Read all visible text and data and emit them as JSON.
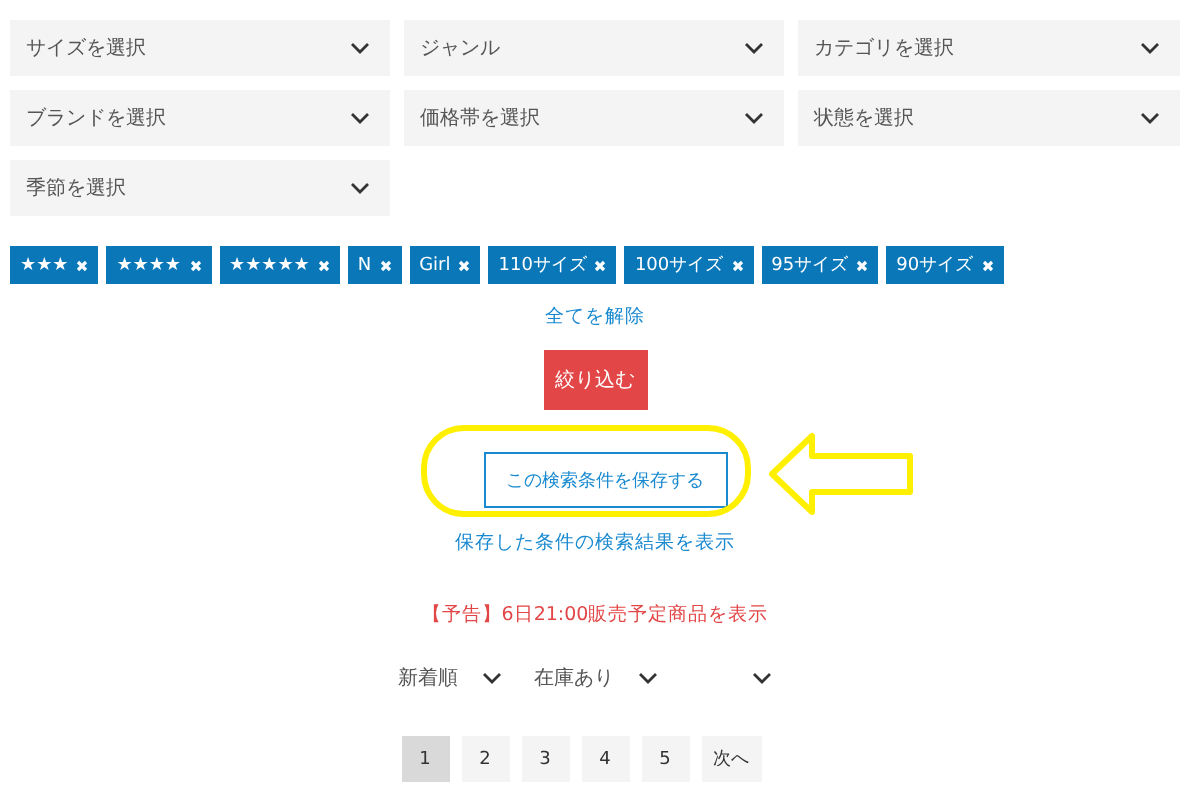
{
  "filters": [
    {
      "label": "サイズを選択"
    },
    {
      "label": "ジャンル"
    },
    {
      "label": "カテゴリを選択"
    },
    {
      "label": "ブランドを選択"
    },
    {
      "label": "価格帯を選択"
    },
    {
      "label": "状態を選択"
    },
    {
      "label": "季節を選択"
    }
  ],
  "tags": [
    {
      "label": "★★★"
    },
    {
      "label": "★★★★"
    },
    {
      "label": "★★★★★"
    },
    {
      "label": "N"
    },
    {
      "label": "Girl"
    },
    {
      "label": "110サイズ"
    },
    {
      "label": "100サイズ"
    },
    {
      "label": "95サイズ"
    },
    {
      "label": "90サイズ"
    }
  ],
  "clear_all": "全てを解除",
  "apply_button": "絞り込む",
  "save_button": "この検索条件を保存する",
  "saved_link": "保存した条件の検索結果を表示",
  "preorder_link": "【予告】6日21:00販売予定商品を表示",
  "sorts": [
    {
      "kind": "select",
      "value": "新着順"
    },
    {
      "kind": "select",
      "value": "在庫あり"
    },
    {
      "kind": "blank"
    }
  ],
  "pages": [
    {
      "label": "1",
      "selected": true
    },
    {
      "label": "2",
      "selected": false
    },
    {
      "label": "3",
      "selected": false
    },
    {
      "label": "4",
      "selected": false
    },
    {
      "label": "5",
      "selected": false
    },
    {
      "label": "次へ",
      "selected": false
    }
  ]
}
